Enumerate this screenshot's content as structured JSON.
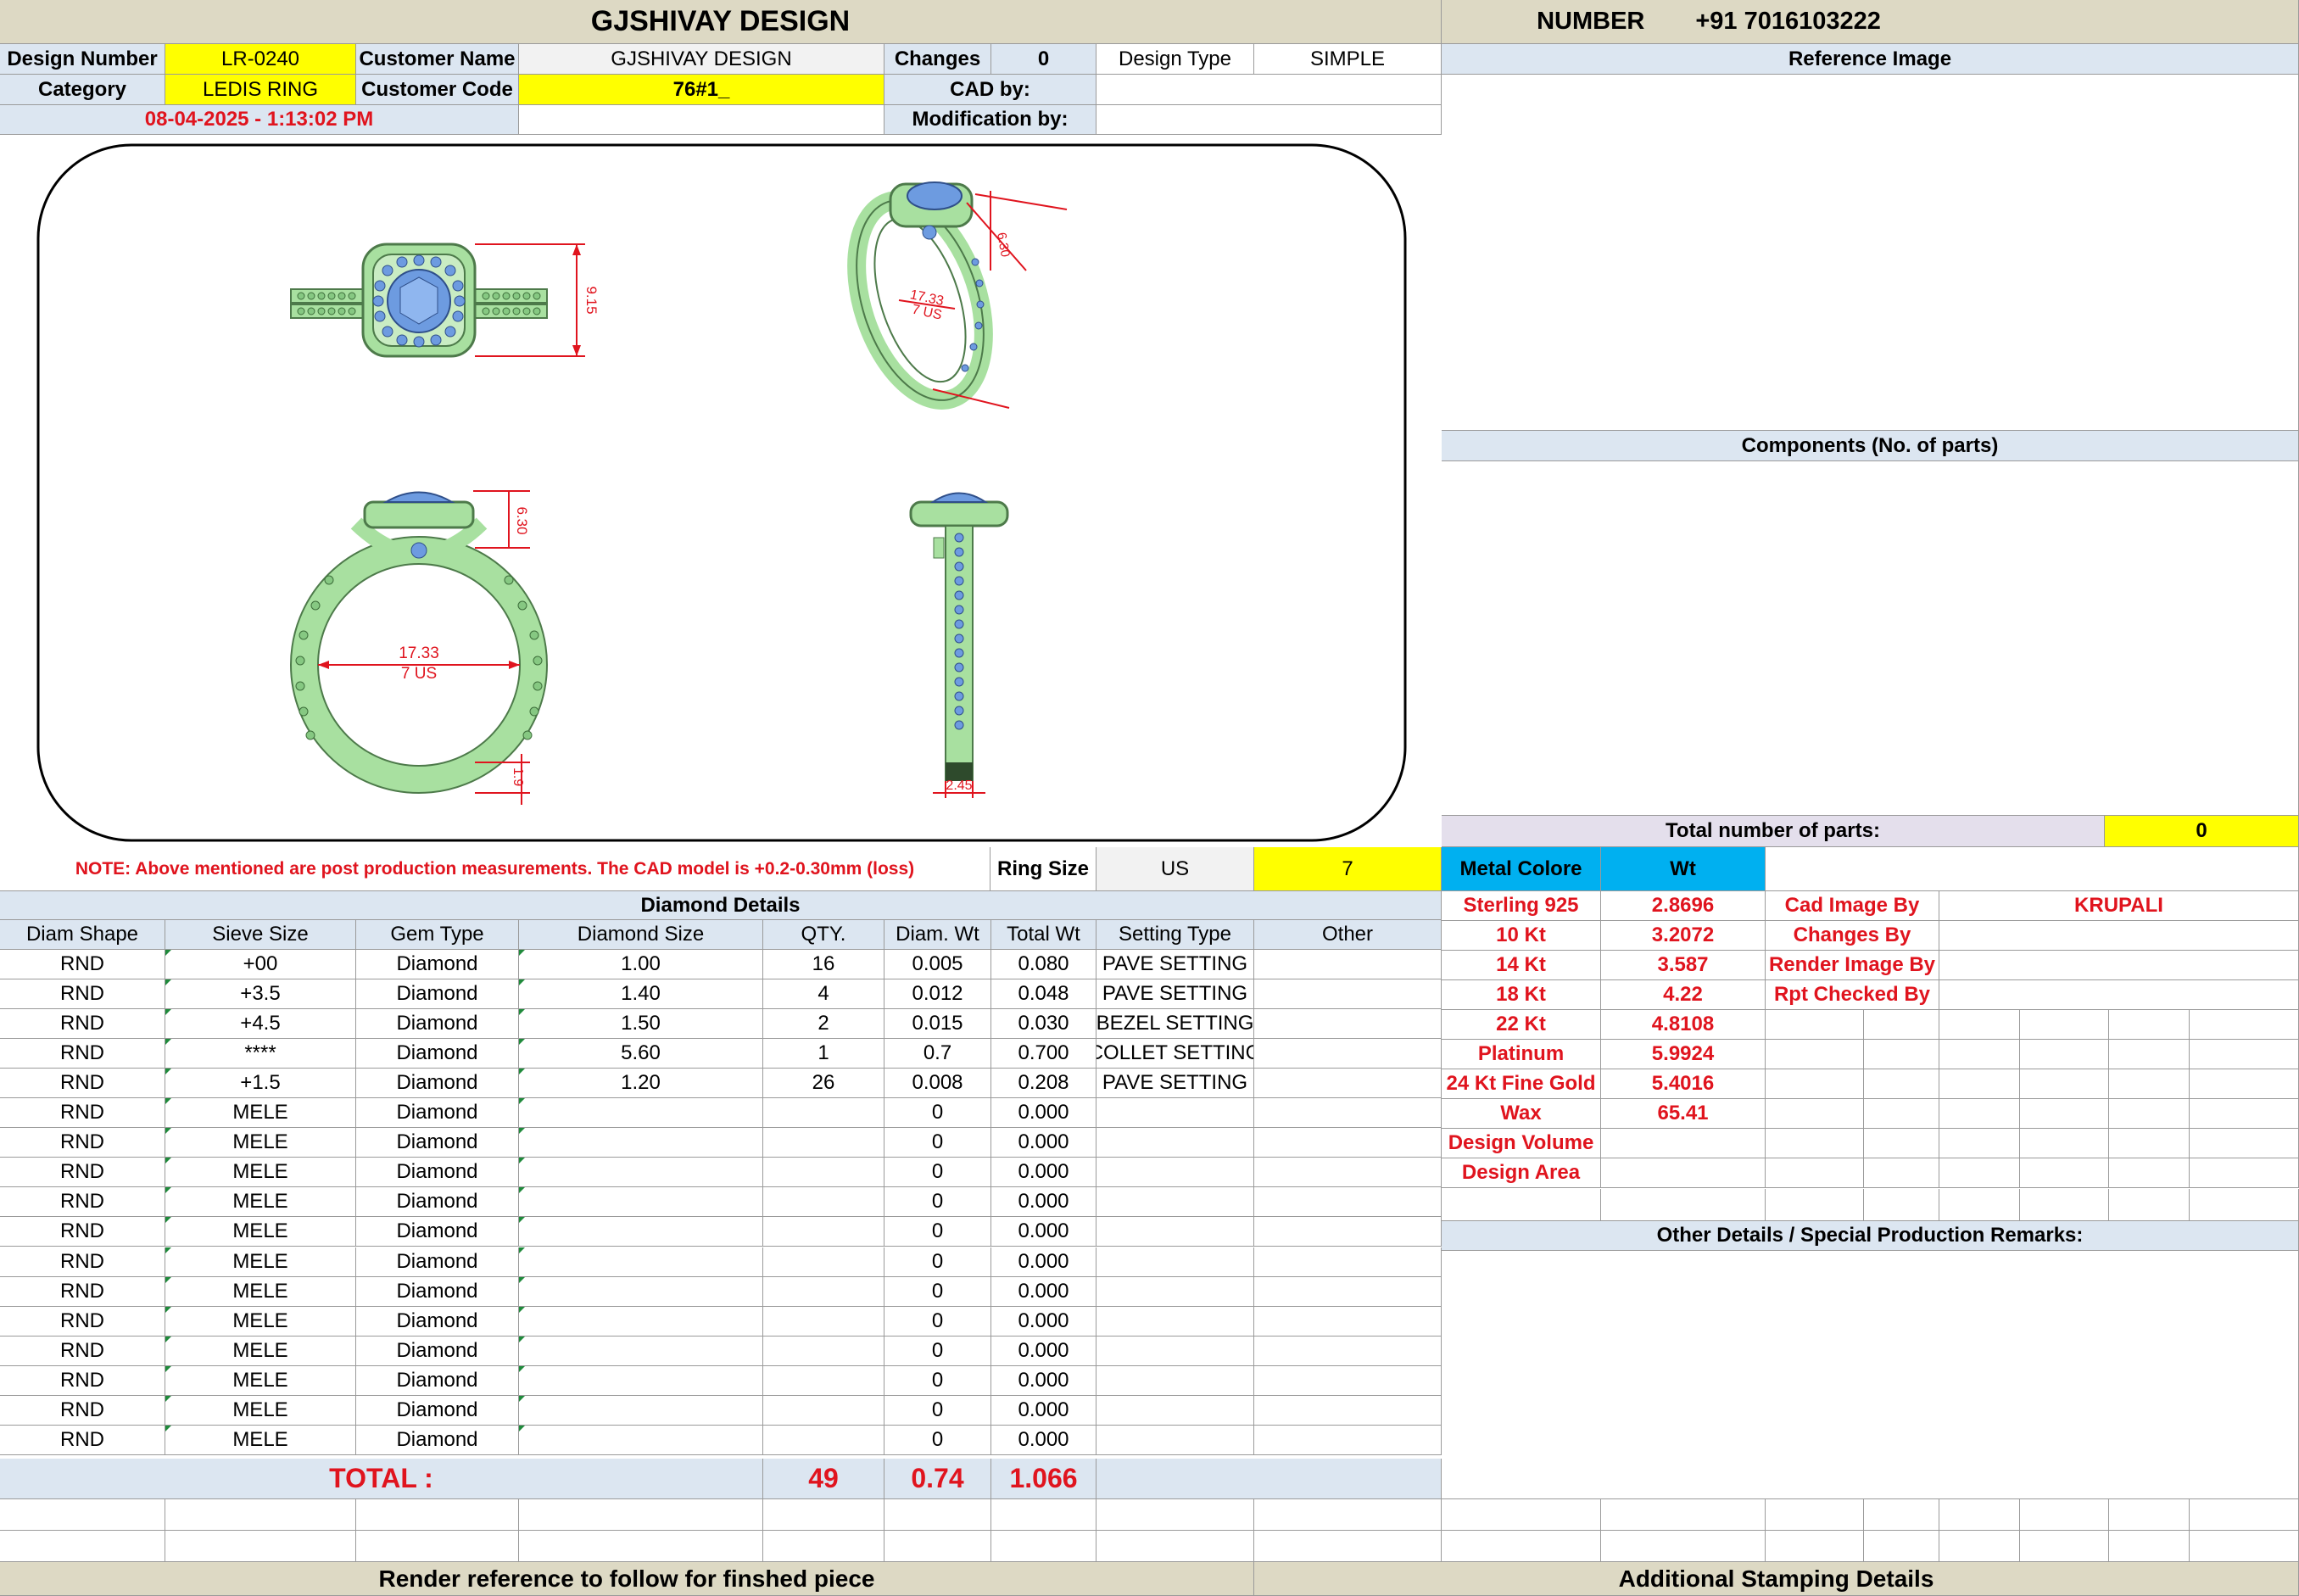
{
  "header": {
    "title": "GJSHIVAY DESIGN",
    "number_label": "NUMBER",
    "number_value": "+91 7016103222"
  },
  "info": {
    "design_number_label": "Design Number",
    "design_number": "LR-0240",
    "customer_name_label": "Customer Name",
    "customer_name": "GJSHIVAY DESIGN",
    "changes_label": "Changes",
    "changes": "0",
    "design_type_label": "Design Type",
    "design_type": "SIMPLE",
    "category_label": "Category",
    "category": "LEDIS RING",
    "customer_code_label": "Customer Code",
    "customer_code": "76#1_",
    "cad_by_label": "CAD by:",
    "timestamp": "08-04-2025 - 1:13:02 PM",
    "modification_by_label": "Modification by:"
  },
  "drawing": {
    "dim_top": "9.15",
    "dim_perspective_a": "17.33",
    "dim_perspective_b": "7 US",
    "dim_perspective_c": "6.30",
    "dim_front_height": "6.30",
    "dim_front_inner_a": "17.33",
    "dim_front_inner_b": "7 US",
    "dim_front_shank": "1.9",
    "dim_side_width": "2.45"
  },
  "note": {
    "text": "NOTE: Above mentioned are post production measurements. The CAD model is +0.2-0.30mm (loss)",
    "ring_size_label": "Ring Size",
    "ring_size_unit": "US",
    "ring_size": "7"
  },
  "right_panel": {
    "reference_image_label": "Reference Image",
    "components_label": "Components (No. of parts)",
    "total_parts_label": "Total number of parts:",
    "total_parts": "0",
    "other_details_label": "Other Details / Special Production Remarks:"
  },
  "diamond": {
    "section_label": "Diamond Details",
    "columns": [
      "Diam Shape",
      "Sieve Size",
      "Gem Type",
      "Diamond Size",
      "QTY.",
      "Diam. Wt",
      "Total Wt",
      "Setting Type",
      "Other"
    ],
    "rows": [
      [
        "RND",
        "+00",
        "Diamond",
        "1.00",
        "16",
        "0.005",
        "0.080",
        "PAVE SETTING",
        ""
      ],
      [
        "RND",
        "+3.5",
        "Diamond",
        "1.40",
        "4",
        "0.012",
        "0.048",
        "PAVE SETTING",
        ""
      ],
      [
        "RND",
        "+4.5",
        "Diamond",
        "1.50",
        "2",
        "0.015",
        "0.030",
        "BEZEL SETTING",
        ""
      ],
      [
        "RND",
        "****",
        "Diamond",
        "5.60",
        "1",
        "0.7",
        "0.700",
        "COLLET SETTING",
        ""
      ],
      [
        "RND",
        "+1.5",
        "Diamond",
        "1.20",
        "26",
        "0.008",
        "0.208",
        "PAVE SETTING",
        ""
      ],
      [
        "RND",
        "MELE",
        "Diamond",
        "",
        "",
        "0",
        "0.000",
        "",
        ""
      ],
      [
        "RND",
        "MELE",
        "Diamond",
        "",
        "",
        "0",
        "0.000",
        "",
        ""
      ],
      [
        "RND",
        "MELE",
        "Diamond",
        "",
        "",
        "0",
        "0.000",
        "",
        ""
      ],
      [
        "RND",
        "MELE",
        "Diamond",
        "",
        "",
        "0",
        "0.000",
        "",
        ""
      ],
      [
        "RND",
        "MELE",
        "Diamond",
        "",
        "",
        "0",
        "0.000",
        "",
        ""
      ],
      [
        "RND",
        "MELE",
        "Diamond",
        "",
        "",
        "0",
        "0.000",
        "",
        ""
      ],
      [
        "RND",
        "MELE",
        "Diamond",
        "",
        "",
        "0",
        "0.000",
        "",
        ""
      ],
      [
        "RND",
        "MELE",
        "Diamond",
        "",
        "",
        "0",
        "0.000",
        "",
        ""
      ],
      [
        "RND",
        "MELE",
        "Diamond",
        "",
        "",
        "0",
        "0.000",
        "",
        ""
      ],
      [
        "RND",
        "MELE",
        "Diamond",
        "",
        "",
        "0",
        "0.000",
        "",
        ""
      ],
      [
        "RND",
        "MELE",
        "Diamond",
        "",
        "",
        "0",
        "0.000",
        "",
        ""
      ],
      [
        "RND",
        "MELE",
        "Diamond",
        "",
        "",
        "0",
        "0.000",
        "",
        ""
      ]
    ],
    "total_label": "TOTAL :",
    "total_qty": "49",
    "total_diam_wt": "0.74",
    "total_wt": "1.066"
  },
  "metal": {
    "header_label": "Metal Colore",
    "header_wt": "Wt",
    "rows": [
      [
        "Sterling 925",
        "2.8696"
      ],
      [
        "10 Kt",
        "3.2072"
      ],
      [
        "14 Kt",
        "3.587"
      ],
      [
        "18 Kt",
        "4.22"
      ],
      [
        "22 Kt",
        "4.8108"
      ],
      [
        "Platinum",
        "5.9924"
      ],
      [
        "24 Kt Fine Gold",
        "5.4016"
      ],
      [
        "Wax",
        "65.41"
      ],
      [
        "Design Volume",
        ""
      ],
      [
        "Design Area",
        ""
      ]
    ]
  },
  "credits": {
    "rows": [
      [
        "Cad Image By",
        "KRUPALI"
      ],
      [
        "Changes By",
        ""
      ],
      [
        "Render Image By",
        ""
      ],
      [
        "Rpt Checked By",
        ""
      ]
    ]
  },
  "footer": {
    "render_reference": "Render reference to follow for finshed piece",
    "stamping": "Additional Stamping Details"
  },
  "colors": {
    "header_tan": "#ddd9c4",
    "label_blue": "#dce6f1",
    "highlight_yellow": "#ffff00",
    "metal_cyan": "#00b0f0",
    "emphasis_red": "#e0141e",
    "ring_green": "#a8e0a0",
    "stone_blue": "#6d9be0"
  }
}
